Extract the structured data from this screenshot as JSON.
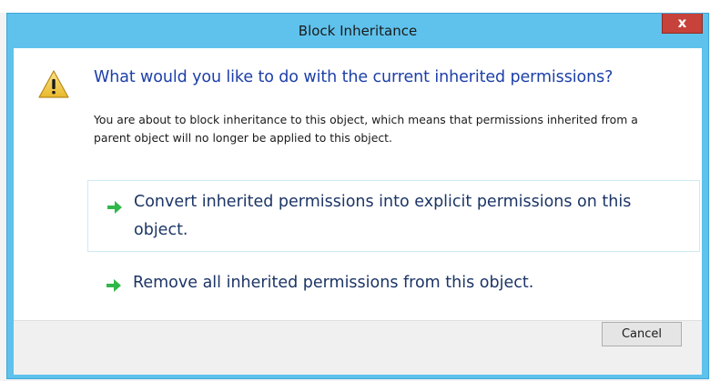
{
  "window": {
    "title": "Block Inheritance",
    "close_label": "x"
  },
  "dialog": {
    "main_instruction": "What would you like to do with the current inherited permissions?",
    "description": "You are about to block inheritance to this object, which means that permissions inherited from a parent object will no longer be applied to this object.",
    "options": [
      {
        "label": "Convert inherited permissions into explicit permissions on this object.",
        "icon": "green-arrow-icon"
      },
      {
        "label": "Remove all inherited permissions from this object.",
        "icon": "green-arrow-icon"
      }
    ],
    "icon": "warning-icon"
  },
  "footer": {
    "cancel_label": "Cancel"
  },
  "colors": {
    "titlebar": "#5fc2ec",
    "instruction": "#1c3fa8",
    "close": "#c7423a",
    "arrow": "#2fb84a"
  }
}
